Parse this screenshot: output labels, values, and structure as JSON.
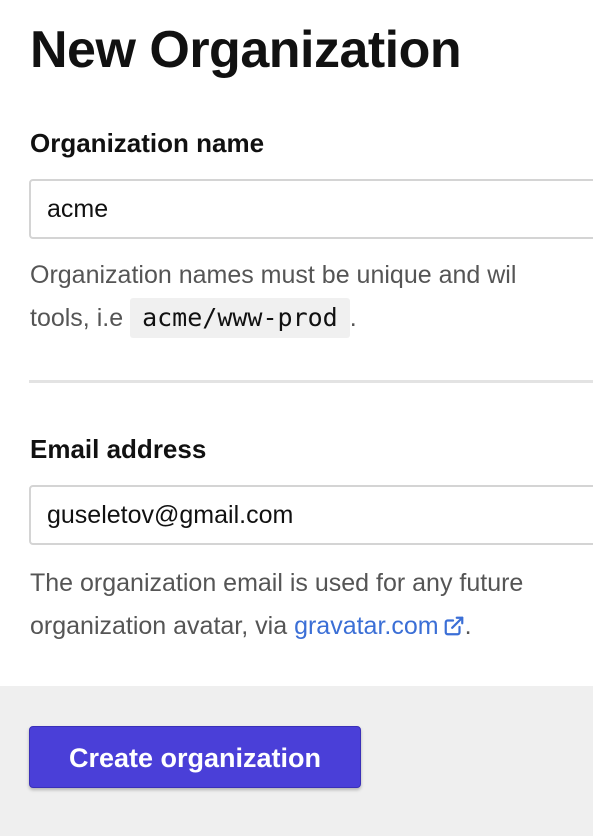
{
  "page": {
    "title": "New Organization"
  },
  "org_name": {
    "label": "Organization name",
    "value": "acme",
    "help_before": "Organization names must be unique and wil",
    "help_line2_before": "tools, i.e ",
    "help_code": "acme/www-prod",
    "help_after": "."
  },
  "email": {
    "label": "Email address",
    "value": "guseletov@gmail.com",
    "help_line1": "The organization email is used for any future",
    "help_line2_before": "organization avatar, via ",
    "link_text": "gravatar.com",
    "help_after": "."
  },
  "actions": {
    "create_label": "Create organization"
  },
  "icons": {
    "external": "external-link-icon"
  },
  "colors": {
    "primary_button": "#4a3fd8",
    "link": "#3b6fd6",
    "footer_bg": "#efefef"
  }
}
